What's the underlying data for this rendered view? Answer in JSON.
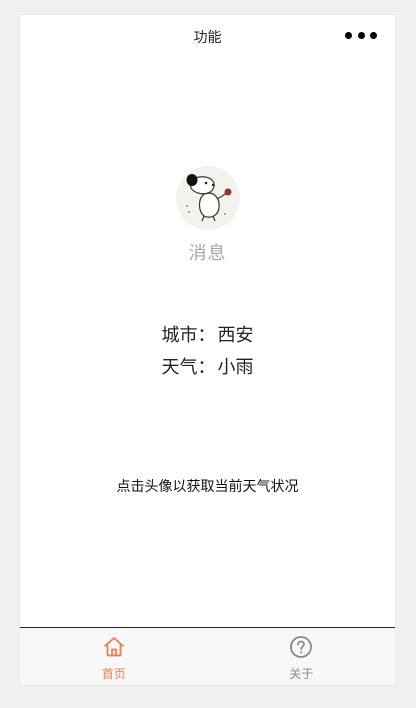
{
  "navbar": {
    "title": "功能",
    "menu_icon": "more-dots-icon"
  },
  "avatar": {
    "icon": "cartoon-dog-avatar",
    "label": "消息"
  },
  "weather": {
    "city_label": "城市：",
    "city_value": "西安",
    "weather_label": "天气：",
    "weather_value": "小雨"
  },
  "hint": "点击头像以获取当前天气状况",
  "tabbar": {
    "tabs": [
      {
        "label": "首页",
        "icon": "home-icon",
        "active": true
      },
      {
        "label": "关于",
        "icon": "question-circle-icon",
        "active": false
      }
    ]
  },
  "colors": {
    "active_tab": "#f07c55",
    "inactive_tab": "#888888",
    "avatar_label": "#a8a8a8"
  }
}
